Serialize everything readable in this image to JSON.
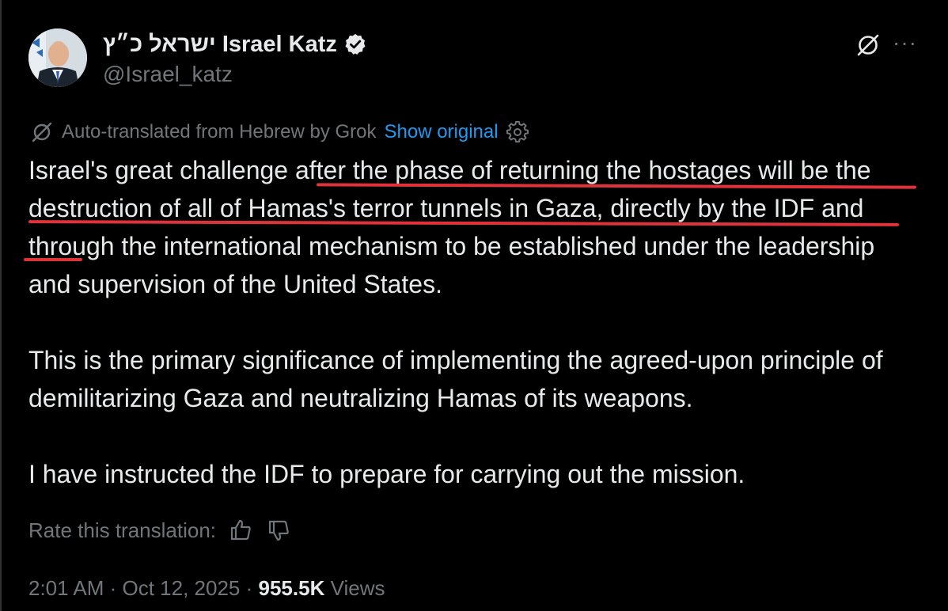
{
  "author": {
    "display_name": "ישראל כ״ץ Israel Katz",
    "handle": "@Israel_katz",
    "avatar_icon": "portrait-avatar",
    "verified_icon": "verified-badge-icon"
  },
  "header_actions": {
    "grok_icon": "grok-icon",
    "more_label": "···"
  },
  "translation": {
    "notice": "Auto-translated from Hebrew by Grok",
    "show_original": "Show original",
    "settings_icon": "gear-icon"
  },
  "tweet": {
    "paragraphs": [
      "Israel's great challenge after the phase of returning the hostages will be the destruction of all of Hamas's terror tunnels in Gaza, directly by the IDF and through the international mechanism to be established under the leadership and supervision of the United States.",
      "This is the primary significance of implementing the agreed-upon principle of demilitarizing Gaza and neutralizing Hamas of its weapons.",
      "I have instructed the IDF to prepare for carrying out the mission."
    ]
  },
  "rating": {
    "label": "Rate this translation:",
    "thumbs_up_icon": "thumbs-up-icon",
    "thumbs_down_icon": "thumbs-down-icon"
  },
  "meta": {
    "time": "2:01 AM",
    "separator": " · ",
    "date": "Oct 12, 2025",
    "views_count": "955.5K",
    "views_label": " Views"
  },
  "colors": {
    "background": "#000000",
    "text": "#e7e9ea",
    "muted": "#71767b",
    "link": "#1d9bf0",
    "underline_annotation": "#e0323a"
  }
}
